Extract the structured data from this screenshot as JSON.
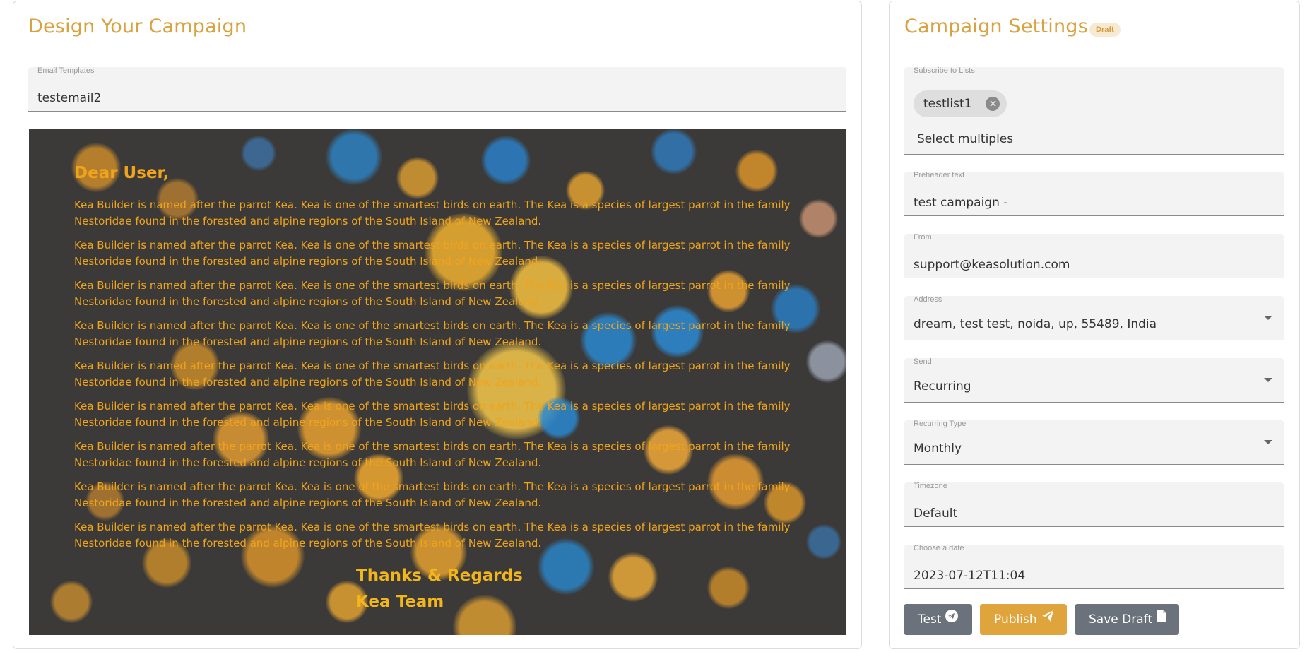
{
  "design": {
    "title": "Design Your Campaign",
    "template_label": "Email Templates",
    "template_value": "testemail2"
  },
  "email_preview": {
    "greeting": "Dear User,",
    "paragraph": "Kea Builder is named after the parrot Kea. Kea is one of the smartest birds on earth. The Kea is a species of largest parrot in the family Nestoridae found in the forested and alpine regions of the South Island of New Zealand.",
    "paragraph_count": 9,
    "signoff": "Thanks & Regards",
    "team": "Kea Team",
    "text_color": "#f0a41c"
  },
  "settings": {
    "title": "Campaign Settings",
    "badge": "Draft",
    "lists_label": "Subscribe to Lists",
    "list_chip": "testlist1",
    "lists_placeholder": "Select multiples",
    "preheader_label": "Preheader text",
    "preheader_value": "test campaign -",
    "from_label": "From",
    "from_value": "support@keasolution.com",
    "address_label": "Address",
    "address_value": "dream, test test, noida, up, 55489, India",
    "send_label": "Send",
    "send_value": "Recurring",
    "recurring_label": "Recurring Type",
    "recurring_value": "Monthly",
    "timezone_label": "Timezone",
    "timezone_value": "Default",
    "date_label": "Choose a date",
    "date_value": "2023-07-12T11:04"
  },
  "actions": {
    "test": "Test",
    "publish": "Publish",
    "save_draft": "Save Draft"
  },
  "colors": {
    "accent": "#d9a23f",
    "button_gray": "#6b727b",
    "button_gold": "#e0a43c"
  },
  "icons": [
    "telegram-icon",
    "paper-plane-icon",
    "file-icon",
    "close-circle-icon",
    "dropdown-caret-icon"
  ]
}
